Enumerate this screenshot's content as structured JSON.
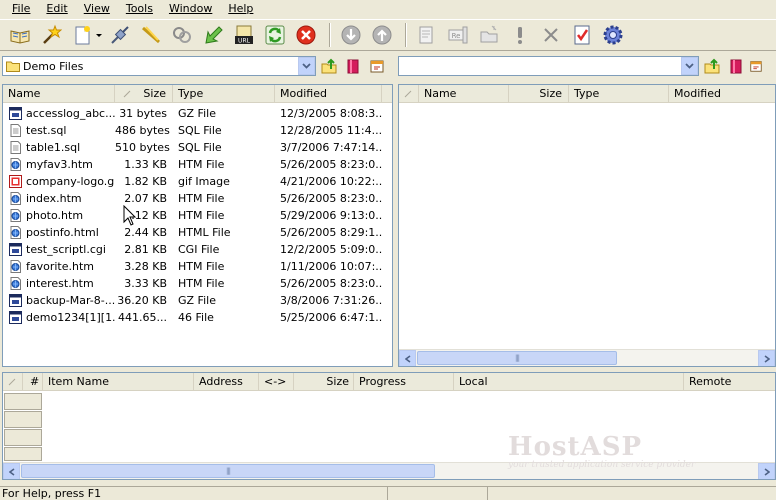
{
  "menu": [
    "File",
    "Edit",
    "View",
    "Tools",
    "Window",
    "Help"
  ],
  "toolbar": {
    "icons": [
      "open-book-icon",
      "magic-wand-icon",
      "new-file-icon",
      "dropdown-arrow-icon",
      "connect-plug-icon",
      "disconnect-icon",
      "sync-icon",
      "download-arrow-icon",
      "url-icon",
      "refresh-icon",
      "stop-icon",
      "move-down-icon",
      "move-up-icon",
      "properties-icon",
      "rename-icon",
      "new-folder-icon",
      "exclamation-icon",
      "delete-icon",
      "checklist-icon",
      "settings-gear-icon"
    ]
  },
  "left_pane": {
    "path": "Demo Files",
    "columns": [
      "Name",
      "Size",
      "Type",
      "Modified"
    ],
    "files": [
      {
        "name": "accesslog_abc...",
        "size": "31 bytes",
        "type": "GZ File",
        "modified": "12/3/2005 8:08:3...",
        "icon": "archive"
      },
      {
        "name": "test.sql",
        "size": "486 bytes",
        "type": "SQL File",
        "modified": "12/28/2005 11:4...",
        "icon": "text"
      },
      {
        "name": "table1.sql",
        "size": "510 bytes",
        "type": "SQL File",
        "modified": "3/7/2006 7:47:14...",
        "icon": "text"
      },
      {
        "name": "myfav3.htm",
        "size": "1.33 KB",
        "type": "HTM File",
        "modified": "5/26/2005 8:23:0...",
        "icon": "web"
      },
      {
        "name": "company-logo.gif",
        "size": "1.82 KB",
        "type": "gif Image",
        "modified": "4/21/2006 10:22:...",
        "icon": "image"
      },
      {
        "name": "index.htm",
        "size": "2.07 KB",
        "type": "HTM File",
        "modified": "5/26/2005 8:23:0...",
        "icon": "web"
      },
      {
        "name": "photo.htm",
        "size": "2.12 KB",
        "type": "HTM File",
        "modified": "5/29/2006 9:13:0...",
        "icon": "web"
      },
      {
        "name": "postinfo.html",
        "size": "2.44 KB",
        "type": "HTML File",
        "modified": "5/26/2005 8:29:1...",
        "icon": "web"
      },
      {
        "name": "test_scriptl.cgi",
        "size": "2.81 KB",
        "type": "CGI File",
        "modified": "12/2/2005 5:09:0...",
        "icon": "archive"
      },
      {
        "name": "favorite.htm",
        "size": "3.28 KB",
        "type": "HTM File",
        "modified": "1/11/2006 10:07:...",
        "icon": "web"
      },
      {
        "name": "interest.htm",
        "size": "3.33 KB",
        "type": "HTM File",
        "modified": "5/26/2005 8:23:0...",
        "icon": "web"
      },
      {
        "name": "backup-Mar-8-...",
        "size": "36.20 KB",
        "type": "GZ File",
        "modified": "3/8/2006 7:31:26...",
        "icon": "archive"
      },
      {
        "name": "demo1234[1][1...",
        "size": "441.65...",
        "type": "46 File",
        "modified": "5/25/2006 6:47:1...",
        "icon": "archive"
      }
    ]
  },
  "right_pane": {
    "path": "",
    "columns": [
      "Name",
      "Size",
      "Type",
      "Modified"
    ]
  },
  "queue": {
    "columns": [
      "#",
      "Item Name",
      "Address",
      "<->",
      "Size",
      "Progress",
      "Local",
      "Remote"
    ]
  },
  "watermark": {
    "title": "HostASP",
    "subtitle": "your trusted application service provider"
  },
  "status": {
    "text": "For Help, press F1"
  },
  "colors": {
    "accent": "#c1d3fb",
    "header": "#ebeadb",
    "window": "#ece9d8",
    "border": "#7f9db9"
  }
}
